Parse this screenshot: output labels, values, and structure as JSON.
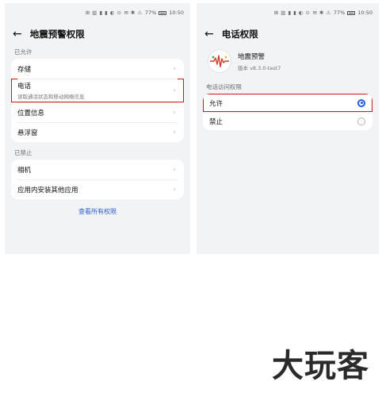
{
  "status_bar": {
    "left_screen": {
      "icons": "⊞ ▥ ▮ ▮ ◐ ⊙",
      "mid_icons": "✉ ✱ ⚠",
      "battery": "77%",
      "time": "10:50"
    },
    "right_screen": {
      "icons": "⊞ ▥ ▮ ▮ ◐ ⊙",
      "mid_icons": "✉ ✱ ⚠",
      "battery": "77%",
      "time": "10:50"
    }
  },
  "left": {
    "title": "地震预警权限",
    "allowed_label": "已允许",
    "allowed": [
      {
        "label": "存储"
      },
      {
        "label": "电话",
        "sub": "读取通话状态和移动网络信息"
      },
      {
        "label": "位置信息"
      },
      {
        "label": "悬浮窗"
      }
    ],
    "denied_label": "已禁止",
    "denied": [
      {
        "label": "相机"
      },
      {
        "label": "应用内安装其他应用"
      }
    ],
    "view_all": "查看所有权限"
  },
  "right": {
    "title": "电话权限",
    "app_name": "地震预警",
    "app_version": "版本 v8.3.0-test7",
    "section_label": "电话访问权限",
    "options": [
      {
        "label": "允许",
        "selected": true
      },
      {
        "label": "禁止",
        "selected": false
      }
    ]
  },
  "watermark": "大玩客",
  "colors": {
    "highlight": "#d2161e",
    "accent": "#1f5fd6",
    "link": "#2d5fd1",
    "background": "#f1f3f5"
  },
  "icons": {
    "back": "arrow-left-icon",
    "chevron": "chevron-right-icon",
    "app_logo": "seismic-wave-icon"
  }
}
